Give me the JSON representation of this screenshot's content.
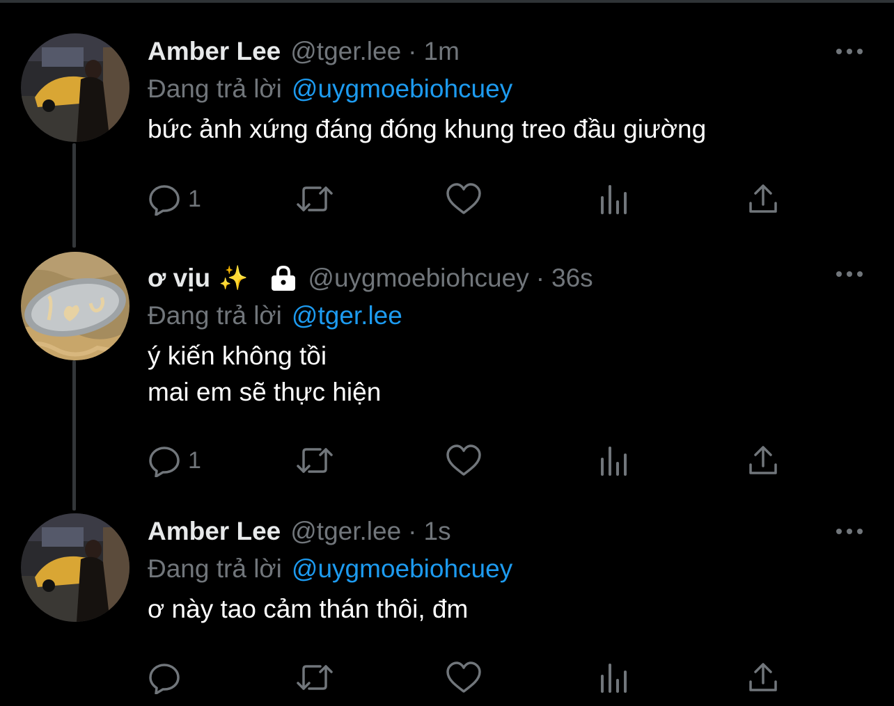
{
  "colors": {
    "background": "#000000",
    "primary_text": "#e7e9ea",
    "secondary_text": "#71767b",
    "accent": "#1d9bf0",
    "thread_line": "#333639"
  },
  "tweets": [
    {
      "name": "Amber Lee",
      "handle": "@tger.lee",
      "separator": "·",
      "time": "1m",
      "reply_prefix": "Đang trả lời",
      "reply_to": "@uygmoebiohcuey",
      "text": "bức ảnh xứng đáng đóng khung treo đầu giường",
      "reply_count": "1",
      "icons": [
        "more-icon",
        "reply-icon",
        "retweet-icon",
        "like-icon",
        "analytics-icon",
        "share-icon"
      ]
    },
    {
      "name": "ơ vịu",
      "name_emoji": "✨",
      "handle": "@uygmoebiohcuey",
      "separator": "·",
      "time": "36s",
      "protected": true,
      "reply_prefix": "Đang trả lời",
      "reply_to": "@tger.lee",
      "text": "ý kiến không tồi\nmai em sẽ thực hiện",
      "reply_count": "1",
      "icons": [
        "lock-icon",
        "more-icon",
        "reply-icon",
        "retweet-icon",
        "like-icon",
        "analytics-icon",
        "share-icon"
      ]
    },
    {
      "name": "Amber Lee",
      "handle": "@tger.lee",
      "separator": "·",
      "time": "1s",
      "reply_prefix": "Đang trả lời",
      "reply_to": "@uygmoebiohcuey",
      "text": "ơ này tao cảm thán thôi, đm",
      "reply_count": "",
      "icons": [
        "more-icon",
        "reply-icon",
        "retweet-icon",
        "like-icon",
        "analytics-icon",
        "share-icon"
      ]
    }
  ]
}
